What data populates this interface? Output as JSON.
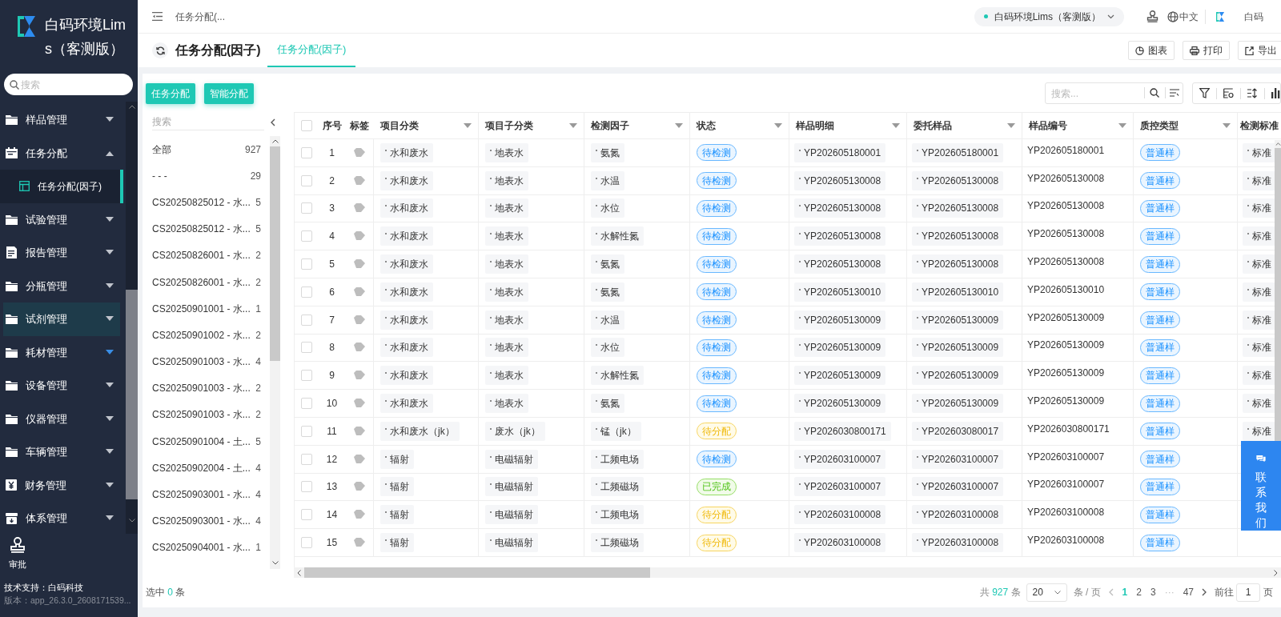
{
  "sidebar": {
    "app_title": "白码环境Lims（客测版）",
    "search": {
      "placeholder": "搜索"
    },
    "menu": [
      {
        "label": "样品管理",
        "kind": "folder",
        "expanded": false,
        "highlighted": false,
        "caret_highlighted": false
      },
      {
        "label": "任务分配",
        "kind": "calendar",
        "expanded": true,
        "highlighted": false,
        "caret_highlighted": false,
        "children": [
          {
            "label": "任务分配(因子)",
            "selected": true
          }
        ]
      },
      {
        "label": "试验管理",
        "kind": "folder",
        "expanded": false,
        "highlighted": false,
        "caret_highlighted": false
      },
      {
        "label": "报告管理",
        "kind": "report",
        "expanded": false,
        "highlighted": false,
        "caret_highlighted": false
      },
      {
        "label": "分瓶管理",
        "kind": "folder",
        "expanded": false,
        "highlighted": false,
        "caret_highlighted": false
      },
      {
        "label": "试剂管理",
        "kind": "folder",
        "expanded": false,
        "highlighted": true,
        "caret_highlighted": false
      },
      {
        "label": "耗材管理",
        "kind": "folder",
        "expanded": false,
        "highlighted": false,
        "caret_highlighted": true
      },
      {
        "label": "设备管理",
        "kind": "folder",
        "expanded": false,
        "highlighted": false,
        "caret_highlighted": false
      },
      {
        "label": "仪器管理",
        "kind": "folder",
        "expanded": false,
        "highlighted": false,
        "caret_highlighted": false
      },
      {
        "label": "车辆管理",
        "kind": "folder",
        "expanded": false,
        "highlighted": false,
        "caret_highlighted": false
      },
      {
        "label": "财务管理",
        "kind": "yen",
        "expanded": false,
        "highlighted": false,
        "caret_highlighted": false
      },
      {
        "label": "体系管理",
        "kind": "archive",
        "expanded": false,
        "highlighted": false,
        "caret_highlighted": false
      }
    ],
    "approval": "审批",
    "support": "技术支持：白码科技",
    "version": "版本：app_26.3.0_2608171539..."
  },
  "topbar": {
    "breadcrumb": "任务分配(...",
    "environment": "白码环境Lims（客测版）",
    "language": "中文",
    "user": "白码"
  },
  "page_header": {
    "title": "任务分配(因子)",
    "tabs": [
      {
        "label": "任务分配(因子)",
        "selected": true
      }
    ],
    "actions": [
      {
        "label": "图表",
        "kind": "chart"
      },
      {
        "label": "打印",
        "kind": "print"
      },
      {
        "label": "导出",
        "kind": "export"
      }
    ]
  },
  "toolbar": {
    "buttons": [
      "任务分配",
      "智能分配"
    ],
    "search": {
      "placeholder": "搜索..."
    }
  },
  "tree": {
    "search": {
      "placeholder": "搜索"
    },
    "items": [
      {
        "label": "全部",
        "count": "927"
      },
      {
        "label": "- - -",
        "count": "29"
      },
      {
        "label": "CS20250825012 - 水...",
        "count": "5"
      },
      {
        "label": "CS20250825012 - 水...",
        "count": "5"
      },
      {
        "label": "CS20250826001 - 水...",
        "count": "2"
      },
      {
        "label": "CS20250826001 - 水...",
        "count": "2"
      },
      {
        "label": "CS20250901001 - 水...",
        "count": "1"
      },
      {
        "label": "CS20250901002 - 水...",
        "count": "2"
      },
      {
        "label": "CS20250901003 - 水...",
        "count": "4"
      },
      {
        "label": "CS20250901003 - 水...",
        "count": "2"
      },
      {
        "label": "CS20250901003 - 水...",
        "count": "2"
      },
      {
        "label": "CS20250901004 - 土...",
        "count": "5"
      },
      {
        "label": "CS20250902004 - 土...",
        "count": "4"
      },
      {
        "label": "CS20250903001 - 水...",
        "count": "4"
      },
      {
        "label": "CS20250903001 - 水...",
        "count": "4"
      },
      {
        "label": "CS20250904001 - 水...",
        "count": "1"
      }
    ]
  },
  "table": {
    "all_checked": false,
    "columns": [
      "序号",
      "标签",
      "项目分类",
      "项目子分类",
      "检测因子",
      "状态",
      "样品明细",
      "委托样品",
      "样品编号",
      "质控类型",
      "检测标准"
    ],
    "rows": [
      {
        "checked": false,
        "no": "1",
        "category": "水和废水",
        "subcategory": "地表水",
        "factor": "氨氮",
        "status": {
          "label": "待检测",
          "kind": "testing"
        },
        "sample_detail": "YP202605180001",
        "entrusted_sample": "YP202605180001",
        "sample_no": "YP202605180001",
        "qc_type": "普通样",
        "standard": "标准"
      },
      {
        "checked": false,
        "no": "2",
        "category": "水和废水",
        "subcategory": "地表水",
        "factor": "水温",
        "status": {
          "label": "待检测",
          "kind": "testing"
        },
        "sample_detail": "YP202605130008",
        "entrusted_sample": "YP202605130008",
        "sample_no": "YP202605130008",
        "qc_type": "普通样",
        "standard": "标准"
      },
      {
        "checked": false,
        "no": "3",
        "category": "水和废水",
        "subcategory": "地表水",
        "factor": "水位",
        "status": {
          "label": "待检测",
          "kind": "testing"
        },
        "sample_detail": "YP202605130008",
        "entrusted_sample": "YP202605130008",
        "sample_no": "YP202605130008",
        "qc_type": "普通样",
        "standard": "标准"
      },
      {
        "checked": false,
        "no": "4",
        "category": "水和废水",
        "subcategory": "地表水",
        "factor": "水解性氮",
        "status": {
          "label": "待检测",
          "kind": "testing"
        },
        "sample_detail": "YP202605130008",
        "entrusted_sample": "YP202605130008",
        "sample_no": "YP202605130008",
        "qc_type": "普通样",
        "standard": "标准"
      },
      {
        "checked": false,
        "no": "5",
        "category": "水和废水",
        "subcategory": "地表水",
        "factor": "氨氮",
        "status": {
          "label": "待检测",
          "kind": "testing"
        },
        "sample_detail": "YP202605130008",
        "entrusted_sample": "YP202605130008",
        "sample_no": "YP202605130008",
        "qc_type": "普通样",
        "standard": "标准"
      },
      {
        "checked": false,
        "no": "6",
        "category": "水和废水",
        "subcategory": "地表水",
        "factor": "氨氮",
        "status": {
          "label": "待检测",
          "kind": "testing"
        },
        "sample_detail": "YP202605130010",
        "entrusted_sample": "YP202605130010",
        "sample_no": "YP202605130010",
        "qc_type": "普通样",
        "standard": "标准"
      },
      {
        "checked": false,
        "no": "7",
        "category": "水和废水",
        "subcategory": "地表水",
        "factor": "水温",
        "status": {
          "label": "待检测",
          "kind": "testing"
        },
        "sample_detail": "YP202605130009",
        "entrusted_sample": "YP202605130009",
        "sample_no": "YP202605130009",
        "qc_type": "普通样",
        "standard": "标准"
      },
      {
        "checked": false,
        "no": "8",
        "category": "水和废水",
        "subcategory": "地表水",
        "factor": "水位",
        "status": {
          "label": "待检测",
          "kind": "testing"
        },
        "sample_detail": "YP202605130009",
        "entrusted_sample": "YP202605130009",
        "sample_no": "YP202605130009",
        "qc_type": "普通样",
        "standard": "标准"
      },
      {
        "checked": false,
        "no": "9",
        "category": "水和废水",
        "subcategory": "地表水",
        "factor": "水解性氮",
        "status": {
          "label": "待检测",
          "kind": "testing"
        },
        "sample_detail": "YP202605130009",
        "entrusted_sample": "YP202605130009",
        "sample_no": "YP202605130009",
        "qc_type": "普通样",
        "standard": "标准"
      },
      {
        "checked": false,
        "no": "10",
        "category": "水和废水",
        "subcategory": "地表水",
        "factor": "氨氮",
        "status": {
          "label": "待检测",
          "kind": "testing"
        },
        "sample_detail": "YP202605130009",
        "entrusted_sample": "YP202605130009",
        "sample_no": "YP202605130009",
        "qc_type": "普通样",
        "standard": "标准"
      },
      {
        "checked": false,
        "no": "11",
        "category": "水和废水（jk）",
        "subcategory": "废水（jk）",
        "factor": "锰（jk）",
        "status": {
          "label": "待分配",
          "kind": "unassigned"
        },
        "sample_detail": "YP2026030800171",
        "entrusted_sample": "YP202603080017",
        "sample_no": "YP2026030800171",
        "qc_type": "普通样",
        "standard": "标准"
      },
      {
        "checked": false,
        "no": "12",
        "category": "辐射",
        "subcategory": "电磁辐射",
        "factor": "工频电场",
        "status": {
          "label": "待检测",
          "kind": "testing"
        },
        "sample_detail": "YP202603100007",
        "entrusted_sample": "YP202603100007",
        "sample_no": "YP202603100007",
        "qc_type": "普通样"
      },
      {
        "checked": false,
        "no": "13",
        "category": "辐射",
        "subcategory": "电磁辐射",
        "factor": "工频磁场",
        "status": {
          "label": "已完成",
          "kind": "done"
        },
        "sample_detail": "YP202603100007",
        "entrusted_sample": "YP202603100007",
        "sample_no": "YP202603100007",
        "qc_type": "普通样"
      },
      {
        "checked": false,
        "no": "14",
        "category": "辐射",
        "subcategory": "电磁辐射",
        "factor": "工频电场",
        "status": {
          "label": "待分配",
          "kind": "unassigned"
        },
        "sample_detail": "YP202603100008",
        "entrusted_sample": "YP202603100008",
        "sample_no": "YP202603100008",
        "qc_type": "普通样"
      },
      {
        "checked": false,
        "no": "15",
        "category": "辐射",
        "subcategory": "电磁辐射",
        "factor": "工频磁场",
        "status": {
          "label": "待分配",
          "kind": "unassigned"
        },
        "sample_detail": "YP202603100008",
        "entrusted_sample": "YP202603100008",
        "sample_no": "YP202603100008",
        "qc_type": "普通样"
      }
    ]
  },
  "footer": {
    "selected_label": "选中",
    "selected_count": "0",
    "selected_unit": "条",
    "pagination": {
      "total_prefix": "共",
      "total": "927",
      "total_suffix": "条",
      "page_size": "20",
      "per_page": "条 / 页",
      "pages": [
        {
          "label": "1",
          "kind": "page",
          "selected": true
        },
        {
          "label": "2",
          "kind": "page",
          "selected": false
        },
        {
          "label": "3",
          "kind": "page",
          "selected": false
        },
        {
          "label": "···",
          "kind": "ellipsis",
          "selected": false
        },
        {
          "label": "47",
          "kind": "page",
          "selected": false
        }
      ],
      "goto_label": "前往",
      "goto_value": "1",
      "goto_suffix": "页"
    }
  },
  "contact": "联系我们"
}
